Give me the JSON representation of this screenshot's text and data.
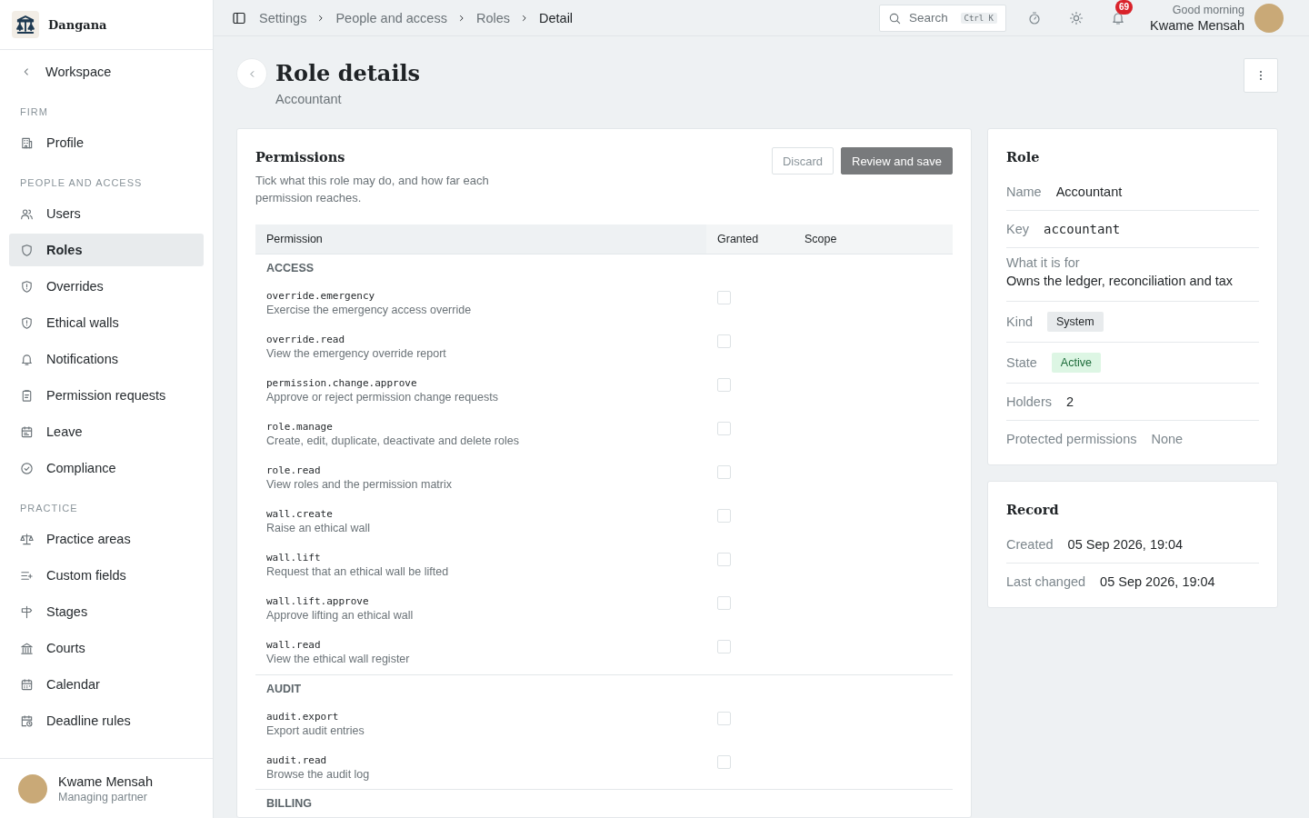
{
  "brand": {
    "name": "Dangana"
  },
  "sidebar": {
    "back": "Workspace",
    "sections": [
      {
        "title": "FIRM",
        "items": [
          {
            "label": "Profile",
            "selected": false
          }
        ]
      },
      {
        "title": "PEOPLE AND ACCESS",
        "items": [
          {
            "label": "Users",
            "selected": false
          },
          {
            "label": "Roles",
            "selected": true
          },
          {
            "label": "Overrides",
            "selected": false
          },
          {
            "label": "Ethical walls",
            "selected": false
          },
          {
            "label": "Notifications",
            "selected": false
          },
          {
            "label": "Permission requests",
            "selected": false
          },
          {
            "label": "Leave",
            "selected": false
          },
          {
            "label": "Compliance",
            "selected": false
          }
        ]
      },
      {
        "title": "PRACTICE",
        "items": [
          {
            "label": "Practice areas",
            "selected": false
          },
          {
            "label": "Custom fields",
            "selected": false
          },
          {
            "label": "Stages",
            "selected": false
          },
          {
            "label": "Courts",
            "selected": false
          },
          {
            "label": "Calendar",
            "selected": false
          },
          {
            "label": "Deadline rules",
            "selected": false
          }
        ]
      }
    ]
  },
  "user": {
    "name": "Kwame Mensah",
    "role": "Managing partner"
  },
  "breadcrumbs": [
    "Settings",
    "People and access",
    "Roles",
    "Detail"
  ],
  "search": {
    "placeholder": "Search",
    "shortcut": "Ctrl K"
  },
  "notifications": {
    "count": "69"
  },
  "greeting": {
    "text": "Good morning",
    "name": "Kwame Mensah"
  },
  "page": {
    "title": "Role details",
    "subtitle": "Accountant"
  },
  "permissions": {
    "title": "Permissions",
    "description": "Tick what this role may do, and how far each permission reaches.",
    "buttons": [
      {
        "label": "Discard",
        "kind": "secondary",
        "disabled": true
      },
      {
        "label": "Review and save",
        "kind": "primary",
        "disabled": true
      }
    ],
    "columns": [
      "Permission",
      "Granted",
      "Scope"
    ],
    "groups": [
      {
        "name": "ACCESS",
        "rows": [
          {
            "key": "override.emergency",
            "description": "Exercise the emergency access override",
            "granted": false
          },
          {
            "key": "override.read",
            "description": "View the emergency override report",
            "granted": false
          },
          {
            "key": "permission.change.approve",
            "description": "Approve or reject permission change requests",
            "granted": false
          },
          {
            "key": "role.manage",
            "description": "Create, edit, duplicate, deactivate and delete roles",
            "granted": false
          },
          {
            "key": "role.read",
            "description": "View roles and the permission matrix",
            "granted": false
          },
          {
            "key": "wall.create",
            "description": "Raise an ethical wall",
            "granted": false
          },
          {
            "key": "wall.lift",
            "description": "Request that an ethical wall be lifted",
            "granted": false
          },
          {
            "key": "wall.lift.approve",
            "description": "Approve lifting an ethical wall",
            "granted": false
          },
          {
            "key": "wall.read",
            "description": "View the ethical wall register",
            "granted": false
          }
        ]
      },
      {
        "name": "AUDIT",
        "rows": [
          {
            "key": "audit.export",
            "description": "Export audit entries",
            "granted": false
          },
          {
            "key": "audit.read",
            "description": "Browse the audit log",
            "granted": false
          }
        ]
      },
      {
        "name": "BILLING"
      }
    ]
  },
  "role": {
    "title": "Role",
    "fields": [
      {
        "label": "Name",
        "value": "Accountant",
        "kind": "text"
      },
      {
        "label": "Key",
        "value": "accountant",
        "kind": "code"
      },
      {
        "label": "What it is for",
        "value": "Owns the ledger, reconciliation and tax",
        "kind": "stacked"
      },
      {
        "label": "Kind",
        "value": "System",
        "kind": "tag"
      },
      {
        "label": "State",
        "value": "Active",
        "kind": "status"
      },
      {
        "label": "Holders",
        "value": "2",
        "kind": "text"
      },
      {
        "label": "Protected permissions",
        "value": "None",
        "kind": "muted"
      }
    ]
  },
  "record": {
    "title": "Record",
    "fields": [
      {
        "label": "Created",
        "value": "05 Sep 2026, 19:04",
        "kind": "text"
      },
      {
        "label": "Last changed",
        "value": "05 Sep 2026, 19:04",
        "kind": "text"
      }
    ]
  }
}
